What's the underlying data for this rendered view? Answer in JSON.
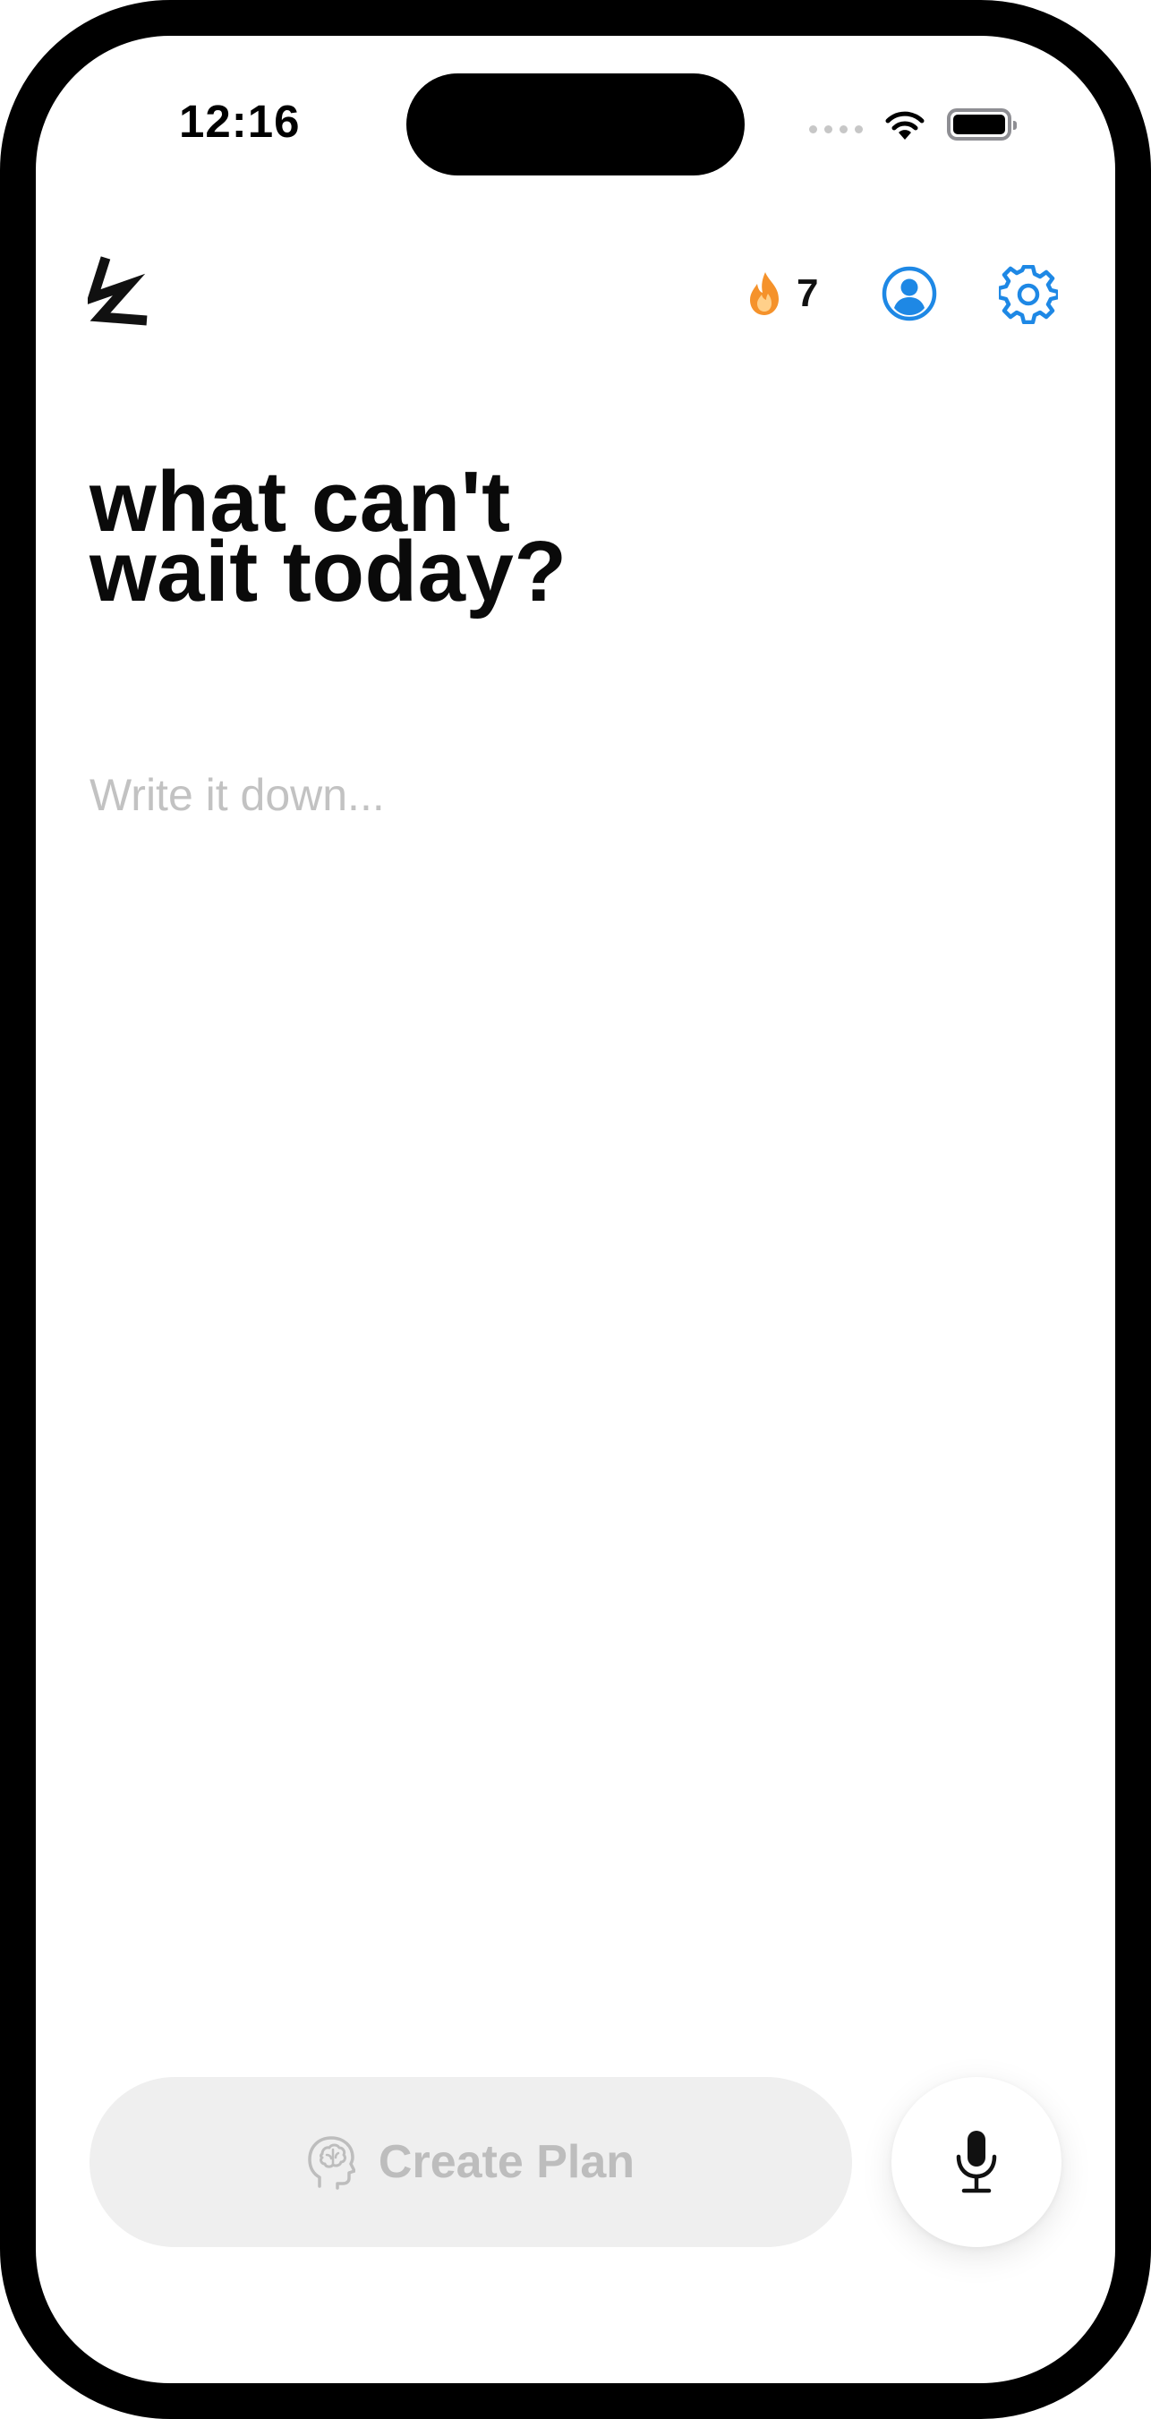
{
  "status_bar": {
    "time": "12:16"
  },
  "header": {
    "logo_icon": "lightning-logo",
    "streak": {
      "icon": "flame-icon",
      "count": "7",
      "color": "#F5922B"
    },
    "profile_icon": "person-circle-icon",
    "settings_icon": "gear-icon",
    "accent_color": "#1E88E5"
  },
  "main": {
    "headline_line1": "what can't",
    "headline_line2": "wait today?",
    "entry": {
      "placeholder": "Write it down...",
      "value": ""
    }
  },
  "footer": {
    "create_plan": {
      "icon": "brain-head-icon",
      "label": "Create Plan",
      "state": "disabled"
    },
    "mic_icon": "microphone-icon"
  }
}
